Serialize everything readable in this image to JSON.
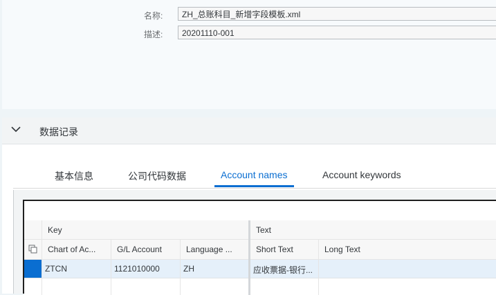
{
  "form": {
    "name_label": "名称:",
    "name_value": "ZH_总账科目_新增字段模板.xml",
    "desc_label": "描述:",
    "desc_value": "20201110-001"
  },
  "section": {
    "title": "数据记录",
    "icon": "chevron-down-icon"
  },
  "tabs": [
    {
      "label": "基本信息"
    },
    {
      "label": "公司代码数据"
    },
    {
      "label": "Account names",
      "active": true
    },
    {
      "label": "Account keywords"
    }
  ],
  "table": {
    "group_headers": [
      "Key",
      "Text"
    ],
    "columns": [
      "Chart of Ac...",
      "G/L Account",
      "Language ...",
      "Short Text",
      "Long Text"
    ],
    "rows": [
      [
        "ZTCN",
        "1121010000",
        "ZH",
        "应收票据-银行...",
        ""
      ]
    ]
  },
  "colors": {
    "accent": "#0a6ed1",
    "row_selected": "#e5f0fa"
  }
}
